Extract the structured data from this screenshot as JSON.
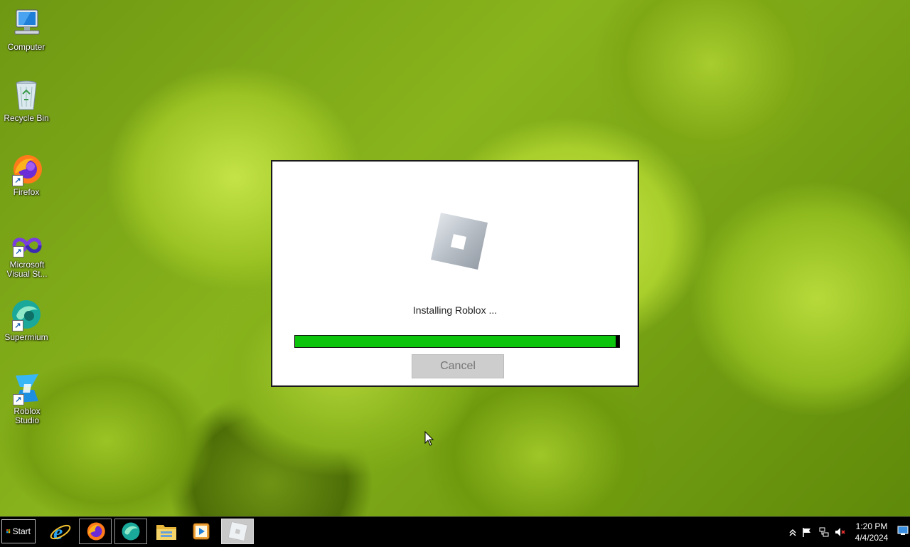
{
  "desktop": {
    "icons": [
      {
        "label": "Computer"
      },
      {
        "label": "Recycle Bin"
      },
      {
        "label": "Firefox"
      },
      {
        "label": "Microsoft Visual St..."
      },
      {
        "label": "Supermium"
      },
      {
        "label": "Roblox Studio"
      }
    ]
  },
  "dialog": {
    "status": "Installing Roblox ...",
    "progress_percent": 99,
    "cancel_label": "Cancel",
    "colors": {
      "progress_fill": "#0bc40b",
      "progress_track": "#000000"
    }
  },
  "taskbar": {
    "start_label": "Start",
    "pinned": [
      {
        "icon": "internet-explorer-icon"
      },
      {
        "icon": "firefox-icon"
      },
      {
        "icon": "supermium-icon"
      },
      {
        "icon": "file-explorer-icon"
      },
      {
        "icon": "media-player-icon"
      },
      {
        "icon": "roblox-icon"
      }
    ],
    "clock": {
      "time": "1:20 PM",
      "date": "4/4/2024"
    }
  }
}
